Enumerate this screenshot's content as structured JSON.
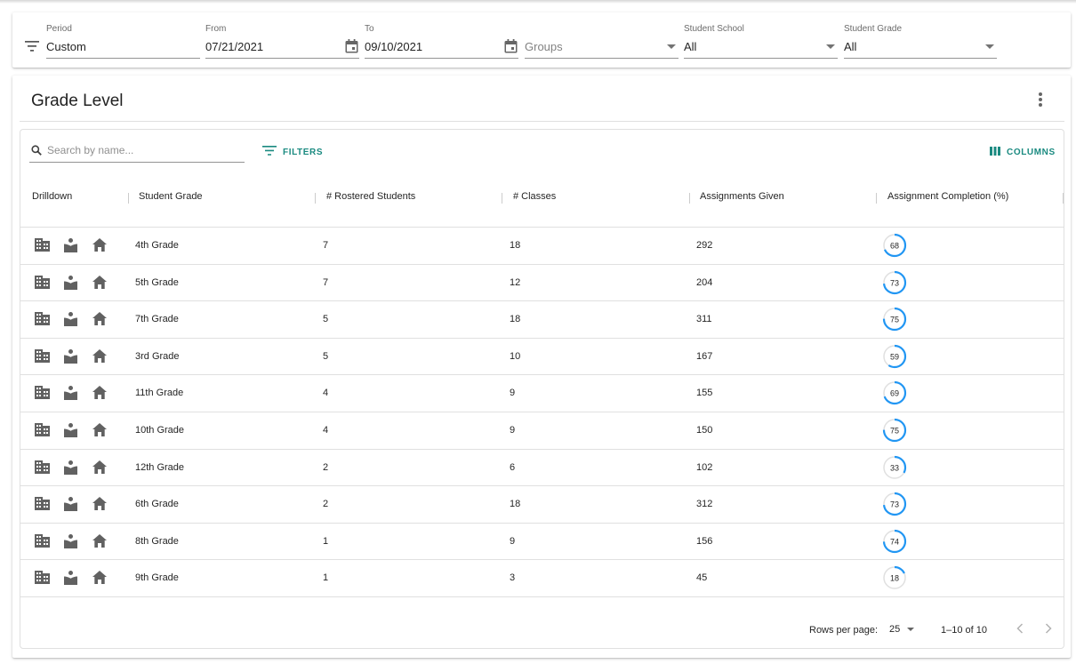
{
  "filters": {
    "period": {
      "label": "Period",
      "value": "Custom"
    },
    "from": {
      "label": "From",
      "value": "07/21/2021"
    },
    "to": {
      "label": "To",
      "value": "09/10/2021"
    },
    "groups": {
      "placeholder": "Groups"
    },
    "school": {
      "label": "Student School",
      "value": "All"
    },
    "grade": {
      "label": "Student Grade",
      "value": "All"
    }
  },
  "card": {
    "title": "Grade Level",
    "search_placeholder": "Search by name...",
    "filters_label": "FILTERS",
    "columns_label": "COLUMNS"
  },
  "columns": [
    "Drilldown",
    "Student Grade",
    "# Rostered Students",
    "# Classes",
    "Assignments Given",
    "Assignment Completion (%)"
  ],
  "rows": [
    {
      "grade": "4th Grade",
      "rostered": "7",
      "classes": "18",
      "assignments": "292",
      "completion": 68
    },
    {
      "grade": "5th Grade",
      "rostered": "7",
      "classes": "12",
      "assignments": "204",
      "completion": 73
    },
    {
      "grade": "7th Grade",
      "rostered": "5",
      "classes": "18",
      "assignments": "311",
      "completion": 75
    },
    {
      "grade": "3rd Grade",
      "rostered": "5",
      "classes": "10",
      "assignments": "167",
      "completion": 59
    },
    {
      "grade": "11th Grade",
      "rostered": "4",
      "classes": "9",
      "assignments": "155",
      "completion": 69
    },
    {
      "grade": "10th Grade",
      "rostered": "4",
      "classes": "9",
      "assignments": "150",
      "completion": 75
    },
    {
      "grade": "12th Grade",
      "rostered": "2",
      "classes": "6",
      "assignments": "102",
      "completion": 33
    },
    {
      "grade": "6th Grade",
      "rostered": "2",
      "classes": "18",
      "assignments": "312",
      "completion": 73
    },
    {
      "grade": "8th Grade",
      "rostered": "1",
      "classes": "9",
      "assignments": "156",
      "completion": 74
    },
    {
      "grade": "9th Grade",
      "rostered": "1",
      "classes": "3",
      "assignments": "45",
      "completion": 18
    }
  ],
  "footer": {
    "rows_per_page_label": "Rows per page:",
    "rows_per_page_value": "25",
    "range": "1–10 of 10"
  },
  "colors": {
    "accent": "#1a8a80",
    "ring": "#2196f3",
    "ring_track": "#e0e0e0",
    "icon": "#616161"
  },
  "icons": {
    "filter": "filter-list-icon",
    "calendar": "calendar-icon",
    "search": "search-icon",
    "columns": "view-column-icon",
    "more": "more-vert-icon",
    "drill_school": "school-building-icon",
    "drill_class": "class-book-icon",
    "drill_home": "home-icon"
  }
}
